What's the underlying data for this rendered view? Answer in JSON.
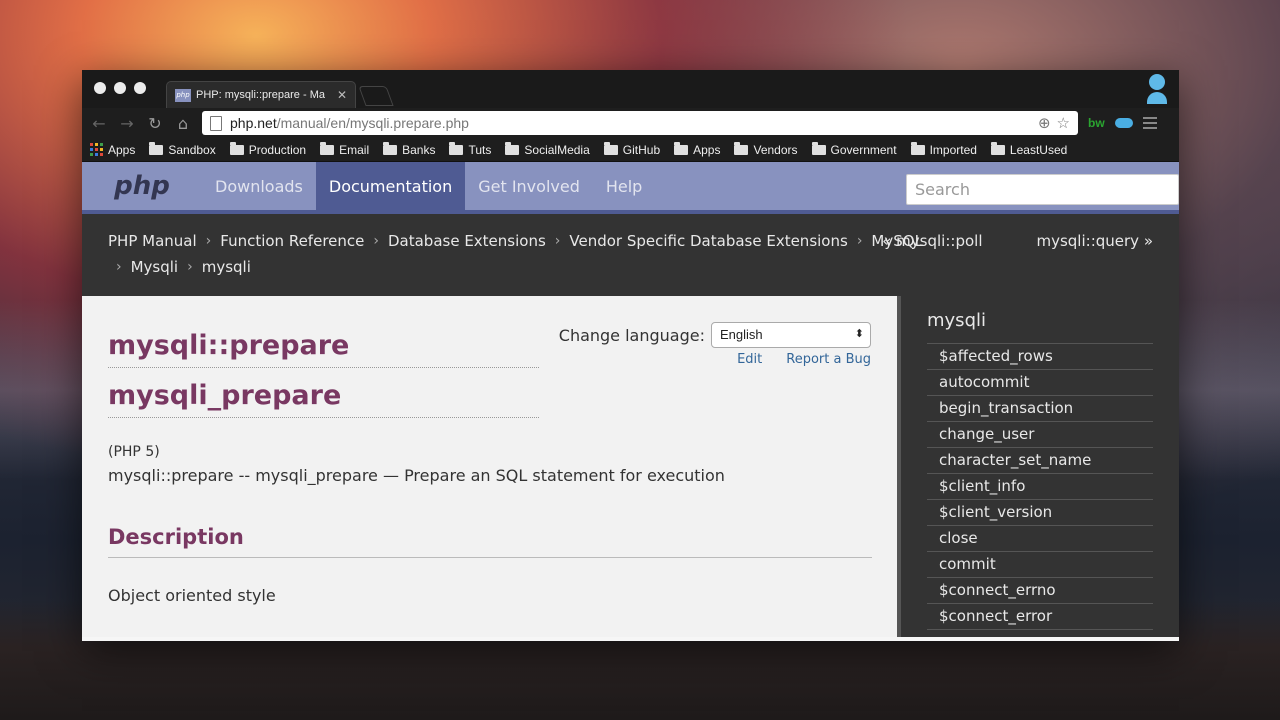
{
  "browser": {
    "tab_title": "PHP: mysqli::prepare - Ma",
    "tab_favicon_text": "php",
    "url_host": "php.net",
    "url_path": "/manual/en/mysqli.prepare.php",
    "extension_text": "bw",
    "bookmarks": [
      "Apps",
      "Sandbox",
      "Production",
      "Email",
      "Banks",
      "Tuts",
      "SocialMedia",
      "GitHub",
      "Apps",
      "Vendors",
      "Government",
      "Imported",
      "LeastUsed"
    ]
  },
  "site": {
    "logo": "php",
    "nav": [
      "Downloads",
      "Documentation",
      "Get Involved",
      "Help"
    ],
    "active_nav": "Documentation",
    "search_placeholder": "Search"
  },
  "breadcrumbs": {
    "items": [
      "PHP Manual",
      "Function Reference",
      "Database Extensions",
      "Vendor Specific Database Extensions",
      "MySQL"
    ],
    "items_line2": [
      "Mysqli",
      "mysqli"
    ],
    "prev": "« mysqli::poll",
    "next": "mysqli::query »"
  },
  "page": {
    "change_language_label": "Change language:",
    "language": "English",
    "edit": "Edit",
    "report_bug": "Report a Bug",
    "refname1": "mysqli::prepare",
    "refname2": "mysqli_prepare",
    "version": "(PHP 5)",
    "purpose": "mysqli::prepare -- mysqli_prepare — Prepare an SQL statement for execution",
    "description_title": "Description",
    "style_label": "Object oriented style"
  },
  "sidebar": {
    "title": "mysqli",
    "items": [
      "$affected_rows",
      "autocommit",
      "begin_transaction",
      "change_user",
      "character_set_name",
      "$client_info",
      "$client_version",
      "close",
      "commit",
      "$connect_errno",
      "$connect_error"
    ]
  },
  "colors": {
    "php_nav": "#8892bf",
    "php_nav_active": "#4f5b93",
    "heading": "#793862",
    "link": "#336699"
  }
}
